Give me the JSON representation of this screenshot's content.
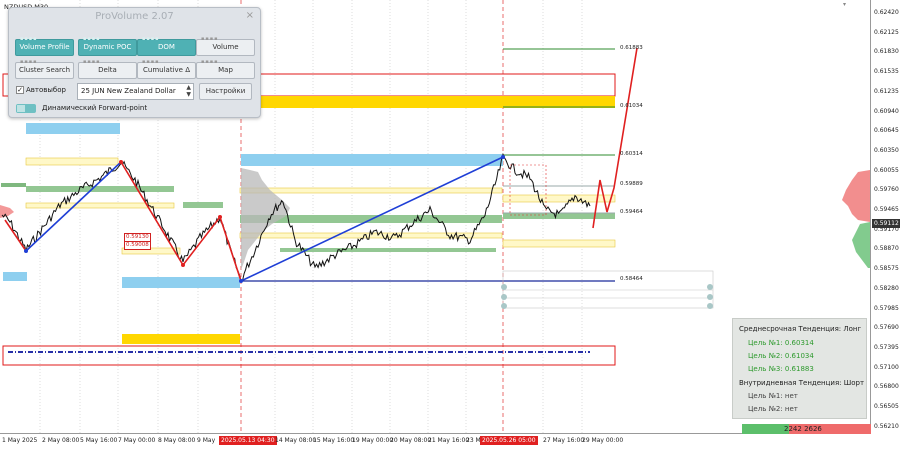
{
  "symbol": "NZDUSD,M30",
  "panel": {
    "title": "ProVolume 2.07",
    "close_icon": "×",
    "buttons": {
      "volume_profile": "Volume Profile",
      "dynamic_poc": "Dynamic POC",
      "dom": "DOM",
      "volume": "Volume",
      "cluster_search": "Cluster Search",
      "delta": "Delta",
      "cumulative_delta": "Cumulative Δ",
      "map": "Map"
    },
    "autoselect_label": "Автовыбор",
    "autoselect_checked": true,
    "instrument": "25 JUN New Zealand Dollar",
    "settings": "Настройки",
    "forward_point": "Динамический Forward-point"
  },
  "price_axis": [
    "0.62420",
    "0.62125",
    "0.61830",
    "0.61535",
    "0.61235",
    "0.60940",
    "0.60645",
    "0.60350",
    "0.60055",
    "0.59760",
    "0.59465",
    "0.59170",
    "0.58870",
    "0.58575",
    "0.58280",
    "0.57985",
    "0.57690",
    "0.57395",
    "0.57100",
    "0.56800",
    "0.56505",
    "0.56210"
  ],
  "current_price": "0.59112",
  "time_axis": [
    {
      "label": "1 May 2025",
      "red": false
    },
    {
      "label": "2 May 08:00",
      "red": false
    },
    {
      "label": "5 May 16:00",
      "red": false
    },
    {
      "label": "7 May 00:00",
      "red": false
    },
    {
      "label": "8 May 08:00",
      "red": false
    },
    {
      "label": "9 May",
      "red": false
    },
    {
      "label": "2025.05.13 04:30",
      "red": true
    },
    {
      "label": "14 May 08:00",
      "red": false
    },
    {
      "label": "15 May 16:00",
      "red": false
    },
    {
      "label": "19 May 00:00",
      "red": false
    },
    {
      "label": "20 May 08:00",
      "red": false
    },
    {
      "label": "21 May 16:00",
      "red": false
    },
    {
      "label": "23 M",
      "red": false
    },
    {
      "label": "2025.05.26 05:00",
      "red": true
    },
    {
      "label": "27 May 16:00",
      "red": false
    },
    {
      "label": "29 May 00:00",
      "red": false
    }
  ],
  "levels": {
    "l1": "0.61883",
    "l2": "0.61034",
    "l3": "0.60314",
    "l4": "0.59889",
    "l5": "0.59464",
    "l6": "0.58464",
    "box_a": "0.59130",
    "box_b": "0.59008"
  },
  "trend": {
    "mid_head": "Среднесрочная Тенденция: Лонг",
    "t1": "Цель №1: 0.60314",
    "t2": "Цель №2: 0.61034",
    "t3": "Цель №3: 0.61883",
    "intra_head": "Внутридневная Тенденция: Шорт",
    "i1": "Цель №1: нет",
    "i2": "Цель №2: нет"
  },
  "volume_bar": {
    "buy": "2242",
    "sell": "2626"
  },
  "colors": {
    "teal_button": "#4fb1b4",
    "uptrend_line": "#1f3fd6",
    "downtrend_line": "#e02020",
    "green_level": "#2e8b2e",
    "zone_blue": "#8ecfef",
    "zone_yellow": "#ffd700"
  }
}
